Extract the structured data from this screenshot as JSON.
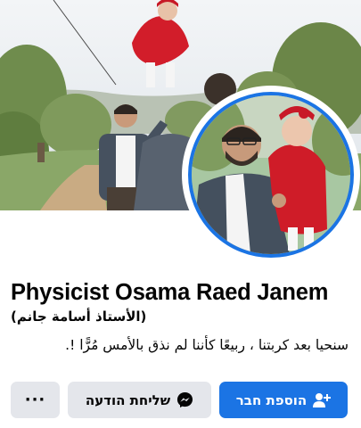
{
  "profile": {
    "name": "Physicist Osama Raed Janem",
    "alt_name": "(الأستاذ أسامة جانم)",
    "bio": "سنحيا بعد كربتنا ، ربيعًا كأننا لم نذق بالأمس مُرًّا !."
  },
  "actions": {
    "add_friend_label": "הוספת חבר",
    "add_friend_icon": "person-plus-icon",
    "message_label": "שליחת הודעה",
    "message_icon": "messenger-icon",
    "more_label": "···"
  },
  "colors": {
    "accent": "#1b74e4",
    "secondary_button": "#e4e6eb",
    "text": "#050505"
  }
}
